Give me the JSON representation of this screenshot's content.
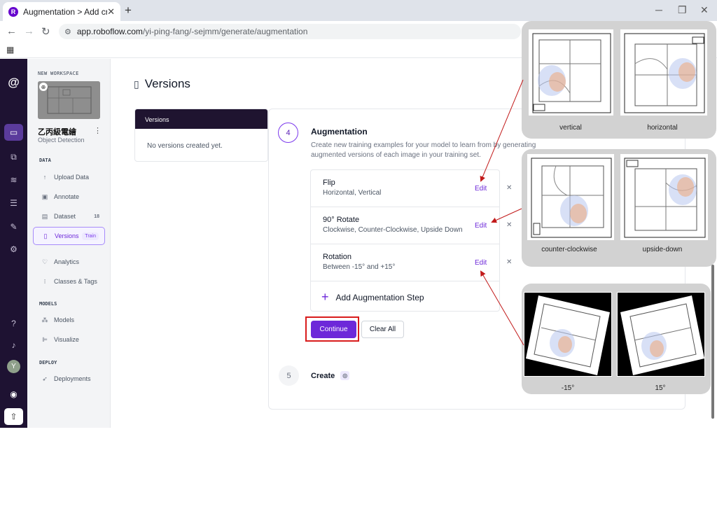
{
  "browser": {
    "tab_title": "Augmentation > Add crop",
    "favicon_letter": "R",
    "url_host": "app.roboflow.com",
    "url_path": "/yi-ping-fang/-sejmm/generate/augmentation"
  },
  "sidebar": {
    "workspace_label": "NEW WORKSPACE",
    "project_name": "乙丙級電繪",
    "project_type": "Object Detection",
    "sections": {
      "data": "DATA",
      "models": "MODELS",
      "deploy": "DEPLOY"
    },
    "items": [
      {
        "label": "Upload Data",
        "icon": "upload-icon"
      },
      {
        "label": "Annotate",
        "icon": "annotate-icon"
      },
      {
        "label": "Dataset",
        "icon": "dataset-icon",
        "badge": "18"
      },
      {
        "label": "Versions",
        "icon": "versions-icon",
        "badge": "Train"
      },
      {
        "label": "Analytics",
        "icon": "analytics-icon"
      },
      {
        "label": "Classes & Tags",
        "icon": "classes-icon"
      },
      {
        "label": "Models",
        "icon": "models-icon"
      },
      {
        "label": "Visualize",
        "icon": "visualize-icon"
      },
      {
        "label": "Deployments",
        "icon": "rocket-icon"
      }
    ],
    "avatar_letter": "Y"
  },
  "main": {
    "title": "Versions",
    "versions_card": {
      "header": "Versions",
      "empty": "No versions created yet."
    },
    "step4": {
      "number": "4",
      "title": "Augmentation",
      "description": "Create new training examples for your model to learn from by generating augmented versions of each image in your training set."
    },
    "augmentation_steps": [
      {
        "name": "Flip",
        "detail": "Horizontal, Vertical",
        "edit": "Edit"
      },
      {
        "name": "90° Rotate",
        "detail": "Clockwise, Counter-Clockwise, Upside Down",
        "edit": "Edit"
      },
      {
        "name": "Rotation",
        "detail": "Between -15° and +15°",
        "edit": "Edit"
      }
    ],
    "add_step": "Add Augmentation Step",
    "continue": "Continue",
    "clear_all": "Clear All",
    "step5": {
      "number": "5",
      "title": "Create"
    }
  },
  "previews": {
    "flip": [
      "vertical",
      "horizontal"
    ],
    "rotate90": [
      "counter-clockwise",
      "upside-down"
    ],
    "rotation": [
      "-15°",
      "15°"
    ]
  },
  "colors": {
    "accent": "#6d28d9",
    "rail_bg": "#1e1232",
    "highlight_box": "#d91c1c",
    "arrow": "#c21a1a"
  }
}
